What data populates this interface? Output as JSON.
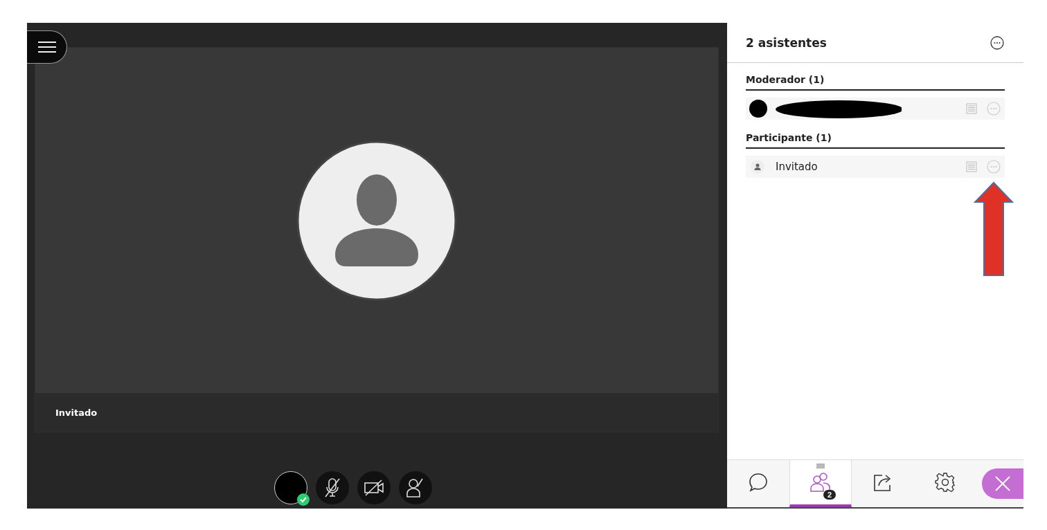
{
  "video": {
    "name": "Invitado"
  },
  "controls": [
    {
      "kind": "avatar"
    },
    {
      "kind": "mic"
    },
    {
      "kind": "camera"
    },
    {
      "kind": "hand"
    }
  ],
  "panel": {
    "title": "2 asistentes"
  },
  "groups": [
    {
      "title": "Moderador (1)",
      "members": [
        {
          "kind": "redacted"
        }
      ]
    },
    {
      "title": "Participante (1)",
      "members": [
        {
          "kind": "guest",
          "name": "Invitado"
        }
      ]
    }
  ],
  "tabs": [
    {
      "kind": "chat",
      "selected": false
    },
    {
      "kind": "attendees",
      "selected": true,
      "badge": "2"
    },
    {
      "kind": "share",
      "selected": false
    },
    {
      "kind": "settings",
      "selected": false
    }
  ],
  "annotation": {
    "kind": "arrow"
  }
}
